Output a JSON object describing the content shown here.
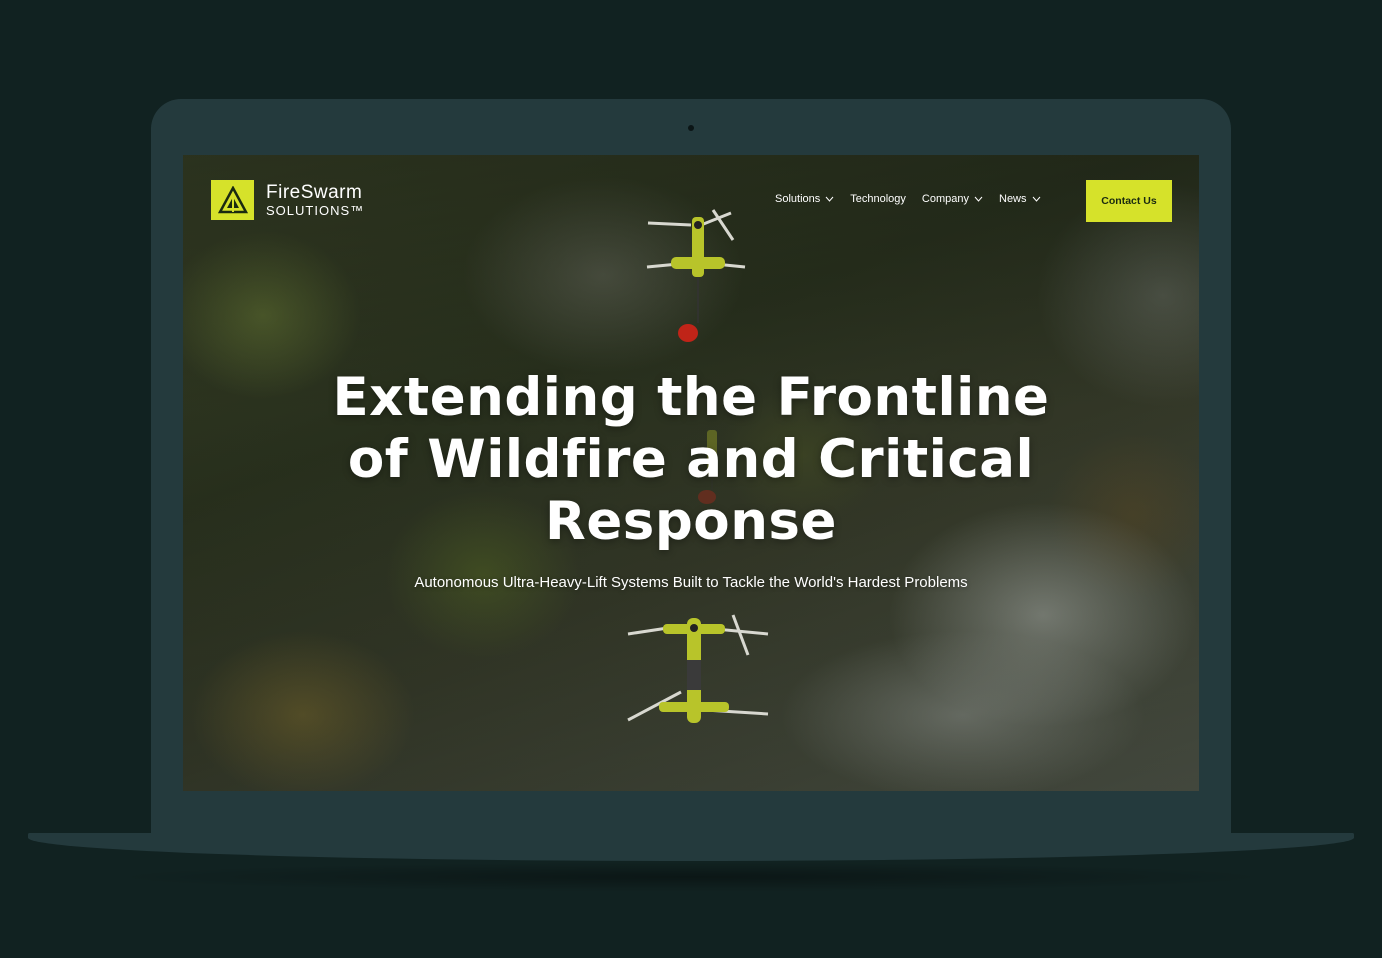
{
  "brand": {
    "name_line1": "FireSwarm",
    "name_line2": "SOLUTIONS™",
    "accent": "#d6e22a"
  },
  "nav": {
    "items": [
      {
        "label": "Solutions",
        "has_dropdown": true
      },
      {
        "label": "Technology",
        "has_dropdown": false
      },
      {
        "label": "Company",
        "has_dropdown": true
      },
      {
        "label": "News",
        "has_dropdown": true
      }
    ],
    "contact_label": "Contact Us"
  },
  "hero": {
    "title_line1": "Extending the Frontline",
    "title_line2": "of Wildfire and Critical",
    "title_line3": "Response",
    "subtitle": "Autonomous Ultra-Heavy-Lift Systems Built to Tackle the World's Hardest Problems"
  },
  "icons": {
    "logo": "fireswarm-logo-icon",
    "dropdown": "chevron-down-icon",
    "drone": "drone-icon"
  }
}
